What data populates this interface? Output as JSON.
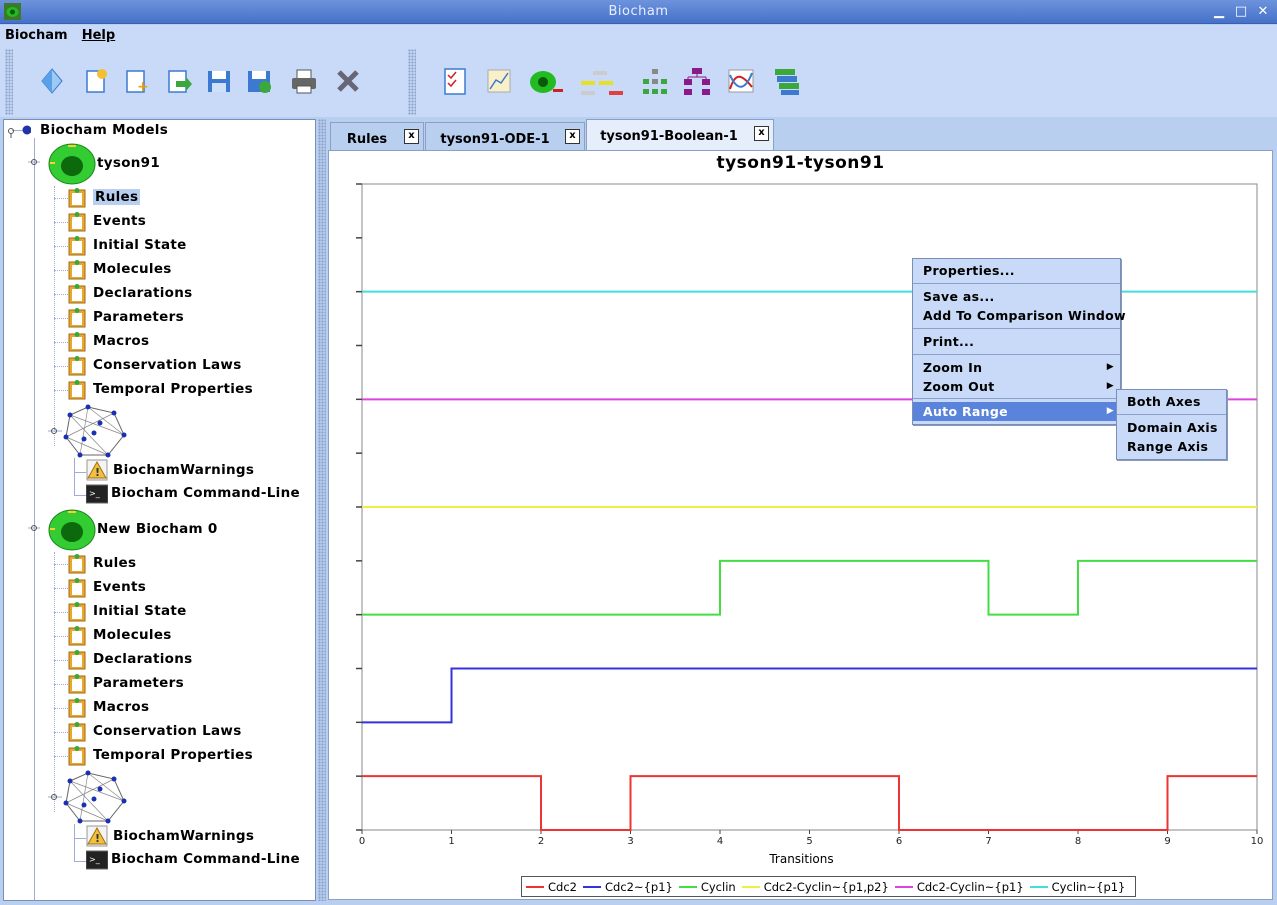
{
  "window": {
    "title": "Biocham"
  },
  "menubar": {
    "items": [
      "Biocham",
      "Help"
    ]
  },
  "tree": {
    "root": "Biocham Models",
    "models": [
      {
        "name": "tyson91",
        "items": [
          "Rules",
          "Events",
          "Initial State",
          "Molecules",
          "Declarations",
          "Parameters",
          "Macros",
          "Conservation Laws",
          "Temporal Properties"
        ],
        "selected": "Rules",
        "warnings": "BiochamWarnings",
        "commandline": "Biocham Command-Line"
      },
      {
        "name": "New Biocham 0",
        "items": [
          "Rules",
          "Events",
          "Initial State",
          "Molecules",
          "Declarations",
          "Parameters",
          "Macros",
          "Conservation Laws",
          "Temporal Properties"
        ],
        "warnings": "BiochamWarnings",
        "commandline": "Biocham Command-Line"
      }
    ]
  },
  "tabs": [
    {
      "label": "Rules",
      "close": "x"
    },
    {
      "label": "tyson91-ODE-1",
      "close": "x"
    },
    {
      "label": "tyson91-Boolean-1",
      "close": "x",
      "active": true
    }
  ],
  "chart_data": {
    "type": "line",
    "title": "tyson91-tyson91",
    "xlabel": "Transitions",
    "ylabel": "",
    "xlim": [
      0,
      10
    ],
    "xticks": [
      "0",
      "1",
      "2",
      "3",
      "4",
      "5",
      "6",
      "7",
      "8",
      "9",
      "10"
    ],
    "step": true,
    "series": [
      {
        "name": "Cdc2",
        "color": "#ee3333",
        "points": [
          [
            0,
            1
          ],
          [
            1,
            1
          ],
          [
            2,
            0
          ],
          [
            3,
            1
          ],
          [
            4,
            1
          ],
          [
            5,
            1
          ],
          [
            6,
            0
          ],
          [
            7,
            0
          ],
          [
            8,
            0
          ],
          [
            9,
            1
          ],
          [
            10,
            1
          ]
        ]
      },
      {
        "name": "Cdc2~{p1}",
        "color": "#3333dd",
        "points": [
          [
            0,
            0
          ],
          [
            1,
            1
          ],
          [
            2,
            1
          ],
          [
            3,
            1
          ],
          [
            4,
            1
          ],
          [
            5,
            1
          ],
          [
            6,
            1
          ],
          [
            7,
            1
          ],
          [
            8,
            1
          ],
          [
            9,
            1
          ],
          [
            10,
            1
          ]
        ]
      },
      {
        "name": "Cyclin",
        "color": "#44dd44",
        "points": [
          [
            0,
            0
          ],
          [
            1,
            0
          ],
          [
            2,
            0
          ],
          [
            3,
            0
          ],
          [
            4,
            1
          ],
          [
            5,
            1
          ],
          [
            6,
            1
          ],
          [
            7,
            0
          ],
          [
            8,
            1
          ],
          [
            9,
            1
          ],
          [
            10,
            1
          ]
        ]
      },
      {
        "name": "Cdc2-Cyclin~{p1,p2}",
        "color": "#eeee44",
        "points": [
          [
            0,
            0
          ],
          [
            10,
            0
          ]
        ]
      },
      {
        "name": "Cdc2-Cyclin~{p1}",
        "color": "#dd44dd",
        "points": [
          [
            0,
            0
          ],
          [
            10,
            0
          ]
        ]
      },
      {
        "name": "Cyclin~{p1}",
        "color": "#44dddd",
        "points": [
          [
            0,
            0
          ],
          [
            10,
            0
          ]
        ]
      }
    ]
  },
  "context_menu": {
    "items": [
      "Properties...",
      "Save as...",
      "Add To Comparison Window",
      "Print...",
      "Zoom In",
      "Zoom Out",
      "Auto Range"
    ],
    "submenu": [
      "Both Axes",
      "Domain Axis",
      "Range Axis"
    ]
  }
}
